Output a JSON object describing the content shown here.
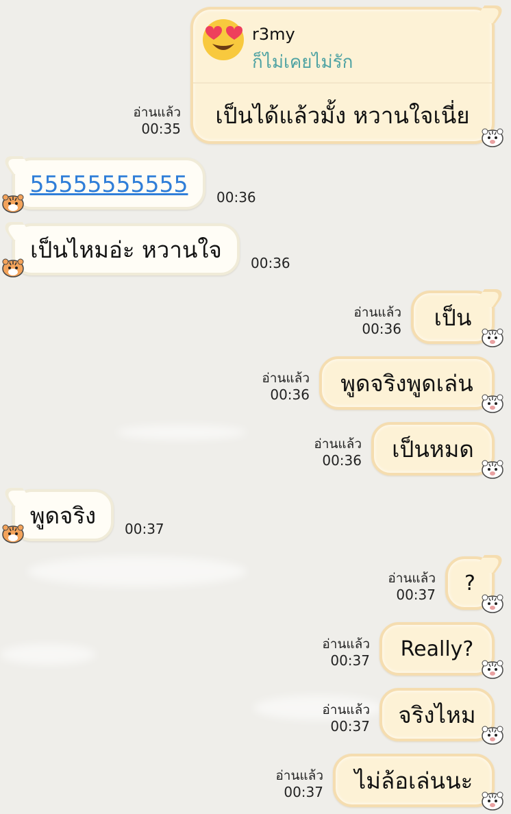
{
  "chat": {
    "read_label": "อ่านแล้ว",
    "reply_card": {
      "quoted_name": "r3my",
      "quoted_text": "ก็ไม่เคยไม่รัก",
      "text": "เป็นได้แล้วมั้ง หวานใจเนี่ย",
      "time": "00:35",
      "avatar_icon": "heart-eyes-emoji-icon"
    },
    "messages": [
      {
        "from": "them",
        "text": "55555555555",
        "time": "00:36",
        "link": true
      },
      {
        "from": "them",
        "text": "เป็นไหมอ่ะ หวานใจ",
        "time": "00:36"
      },
      {
        "from": "me",
        "text": "เป็น",
        "time": "00:36"
      },
      {
        "from": "me",
        "text": "พูดจริงพูดเล่น",
        "time": "00:36"
      },
      {
        "from": "me",
        "text": "เป็นหมด",
        "time": "00:36"
      },
      {
        "from": "them",
        "text": "พูดจริง",
        "time": "00:37"
      },
      {
        "from": "me",
        "text": "?",
        "time": "00:37"
      },
      {
        "from": "me",
        "text": "Really?",
        "time": "00:37"
      },
      {
        "from": "me",
        "text": "จริงไหม",
        "time": "00:37"
      },
      {
        "from": "me",
        "text": "ไม่ล้อเล่นนะ",
        "time": "00:37"
      }
    ]
  },
  "colors": {
    "background": "#efeeea",
    "my_bubble": "#fdf2d6",
    "their_bubble": "#fffdf6",
    "quote_text": "#4fa3a3",
    "link": "#2f7ed8"
  },
  "icons": {
    "my_sticker": "white-tiger-face-icon",
    "their_sticker": "tiger-face-icon"
  }
}
